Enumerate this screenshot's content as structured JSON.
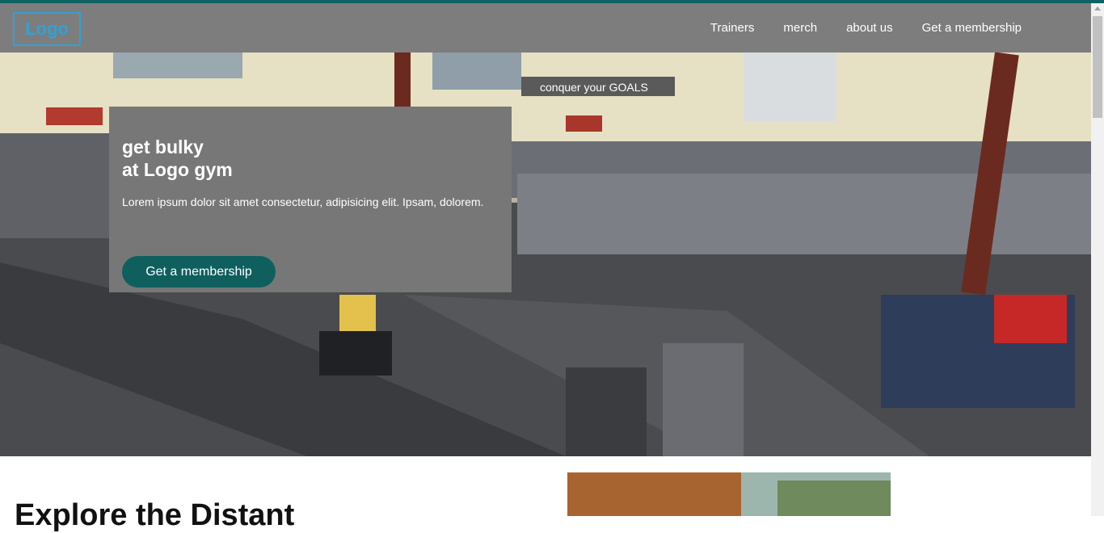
{
  "nav": {
    "logo": "Logo",
    "links": [
      "Trainers",
      "merch",
      "about us",
      "Get a membership"
    ]
  },
  "hero": {
    "title_line1": "get bulky",
    "title_line2": "at Logo gym",
    "text": "Lorem ipsum dolor sit amet consectetur, adipisicing elit. Ipsam, dolorem.",
    "cta": "Get a membership",
    "banner_text": "conquer your GOALS"
  },
  "section": {
    "title": "Explore the Distant"
  },
  "colors": {
    "accent": "#0f5f5f",
    "logo": "#2ea2d8",
    "nav_bg": "#7d7d7d"
  }
}
